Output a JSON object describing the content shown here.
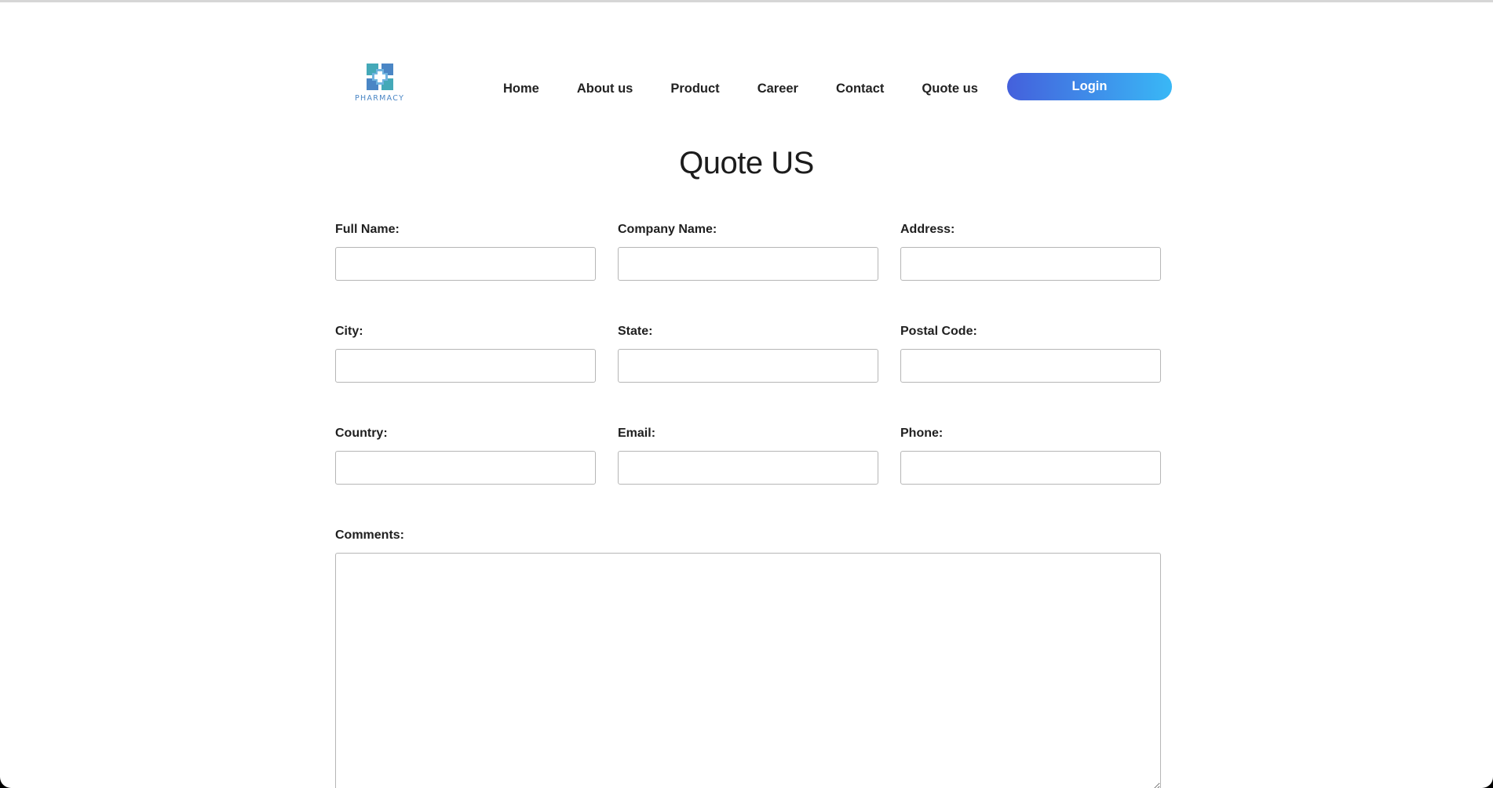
{
  "brand": {
    "logo_text": "PHARMACY",
    "colors": {
      "logo_teal": "#44a9b8",
      "logo_blue": "#4a86c5",
      "login_gradient_start": "#4460dc",
      "login_gradient_end": "#39b8f6"
    }
  },
  "nav": {
    "items": [
      {
        "label": "Home"
      },
      {
        "label": "About us"
      },
      {
        "label": "Product"
      },
      {
        "label": "Career"
      },
      {
        "label": "Contact"
      },
      {
        "label": "Quote us"
      }
    ],
    "login_label": "Login"
  },
  "page": {
    "title": "Quote US"
  },
  "form": {
    "fields": [
      {
        "label": "Full Name:",
        "value": ""
      },
      {
        "label": "Company Name:",
        "value": ""
      },
      {
        "label": "Address:",
        "value": ""
      },
      {
        "label": "City:",
        "value": ""
      },
      {
        "label": "State:",
        "value": ""
      },
      {
        "label": "Postal Code:",
        "value": ""
      },
      {
        "label": "Country:",
        "value": ""
      },
      {
        "label": "Email:",
        "value": ""
      },
      {
        "label": "Phone:",
        "value": ""
      }
    ],
    "comments": {
      "label": "Comments:",
      "value": ""
    }
  }
}
